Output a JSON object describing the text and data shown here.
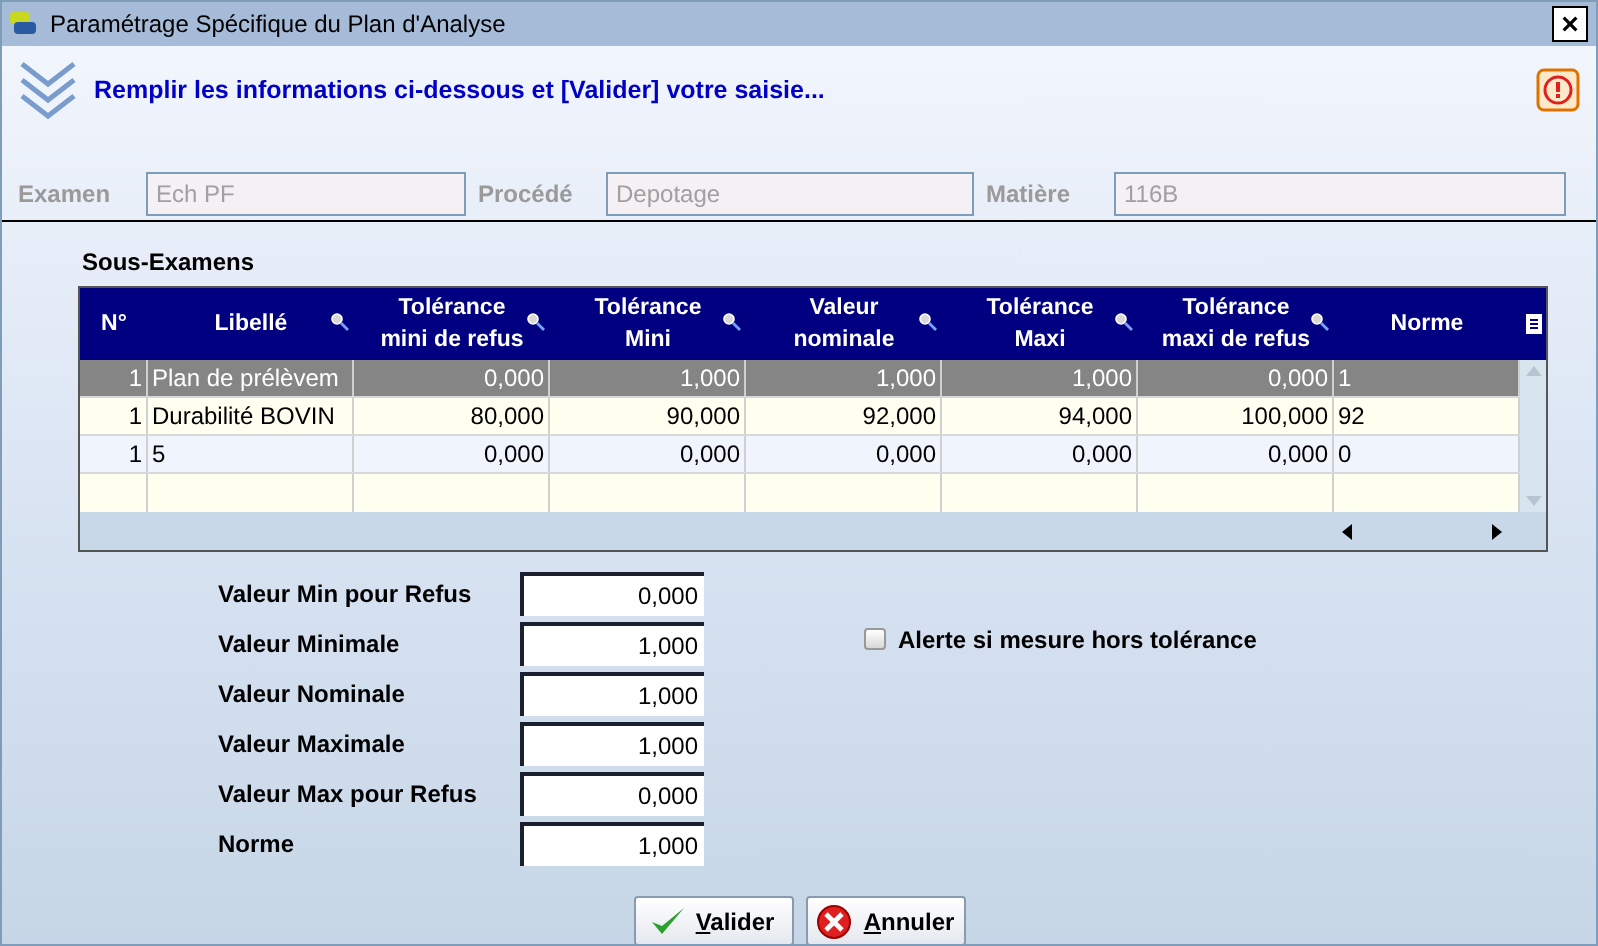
{
  "window": {
    "title": "Paramétrage Spécifique du Plan d'Analyse",
    "close": "×"
  },
  "header": {
    "message": "Remplir les informations ci-dessous et [Valider] votre saisie..."
  },
  "fields": [
    {
      "label": "Examen",
      "value": "Ech PF",
      "disabled": true
    },
    {
      "label": "Procédé",
      "value": "Depotage",
      "disabled": true
    },
    {
      "label": "Matière",
      "value": "116B",
      "disabled": true
    }
  ],
  "table": {
    "title": "Sous-Examens",
    "columns": [
      {
        "label": "N°",
        "kind": "number",
        "searchable": false
      },
      {
        "label": "Libellé",
        "kind": "text",
        "searchable": true
      },
      {
        "label": "Tolérance\nmini de refus",
        "kind": "number",
        "searchable": true
      },
      {
        "label": "Tolérance\nMini",
        "kind": "number",
        "searchable": true
      },
      {
        "label": "Valeur\nnominale",
        "kind": "number",
        "searchable": true
      },
      {
        "label": "Tolérance\nMaxi",
        "kind": "number",
        "searchable": true
      },
      {
        "label": "Tolérance\nmaxi de refus",
        "kind": "number",
        "searchable": true
      },
      {
        "label": "Norme",
        "kind": "text",
        "searchable": false
      }
    ],
    "rows": [
      {
        "selected": true,
        "cells": [
          "1",
          "Plan de prélèvem",
          "0,000",
          "1,000",
          "1,000",
          "1,000",
          "0,000",
          "1"
        ]
      },
      {
        "selected": false,
        "cells": [
          "1",
          "Durabilité BOVIN",
          "80,000",
          "90,000",
          "92,000",
          "94,000",
          "100,000",
          "92"
        ]
      },
      {
        "selected": false,
        "cells": [
          "1",
          "5",
          "0,000",
          "0,000",
          "0,000",
          "0,000",
          "0,000",
          "0"
        ]
      }
    ]
  },
  "form_fields": [
    {
      "label": "Valeur Min pour Refus",
      "value": "0,000"
    },
    {
      "label": "Valeur Minimale",
      "value": "1,000"
    },
    {
      "label": "Valeur Nominale",
      "value": "1,000"
    },
    {
      "label": "Valeur Maximale",
      "value": "1,000"
    },
    {
      "label": "Valeur Max pour Refus",
      "value": "0,000"
    },
    {
      "label": "Norme",
      "value": "1,000"
    }
  ],
  "alert": {
    "label": "Alerte si mesure hors tolérance",
    "checked": false
  },
  "buttons": [
    {
      "label": "Valider",
      "kind": "ok"
    },
    {
      "label": "Annuler",
      "kind": "cancel"
    }
  ]
}
